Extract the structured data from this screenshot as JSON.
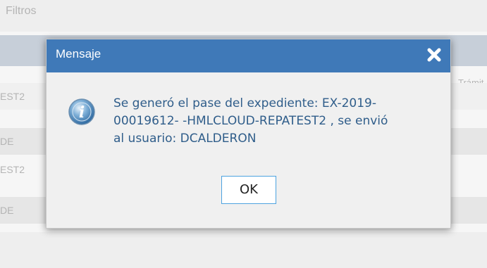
{
  "background": {
    "filters_label": "Filtros",
    "column_partial": "Trámit",
    "rows": [
      "EST2",
      "DE",
      "EST2",
      "DE"
    ]
  },
  "dialog": {
    "title": "Mensaje",
    "close_icon": "close-x-icon",
    "info_icon": "info-icon",
    "message_line1": "Se generó el pase del expediente: EX-2019-",
    "message_line2": "00019612- -HMLCLOUD-REPATEST2 , se envió",
    "message_line3": "al usuario: DCALDERON",
    "ok_label": "OK"
  },
  "colors": {
    "header": "#3f79b8",
    "message_text": "#2f5d8a",
    "ok_border": "#4da3e0"
  }
}
